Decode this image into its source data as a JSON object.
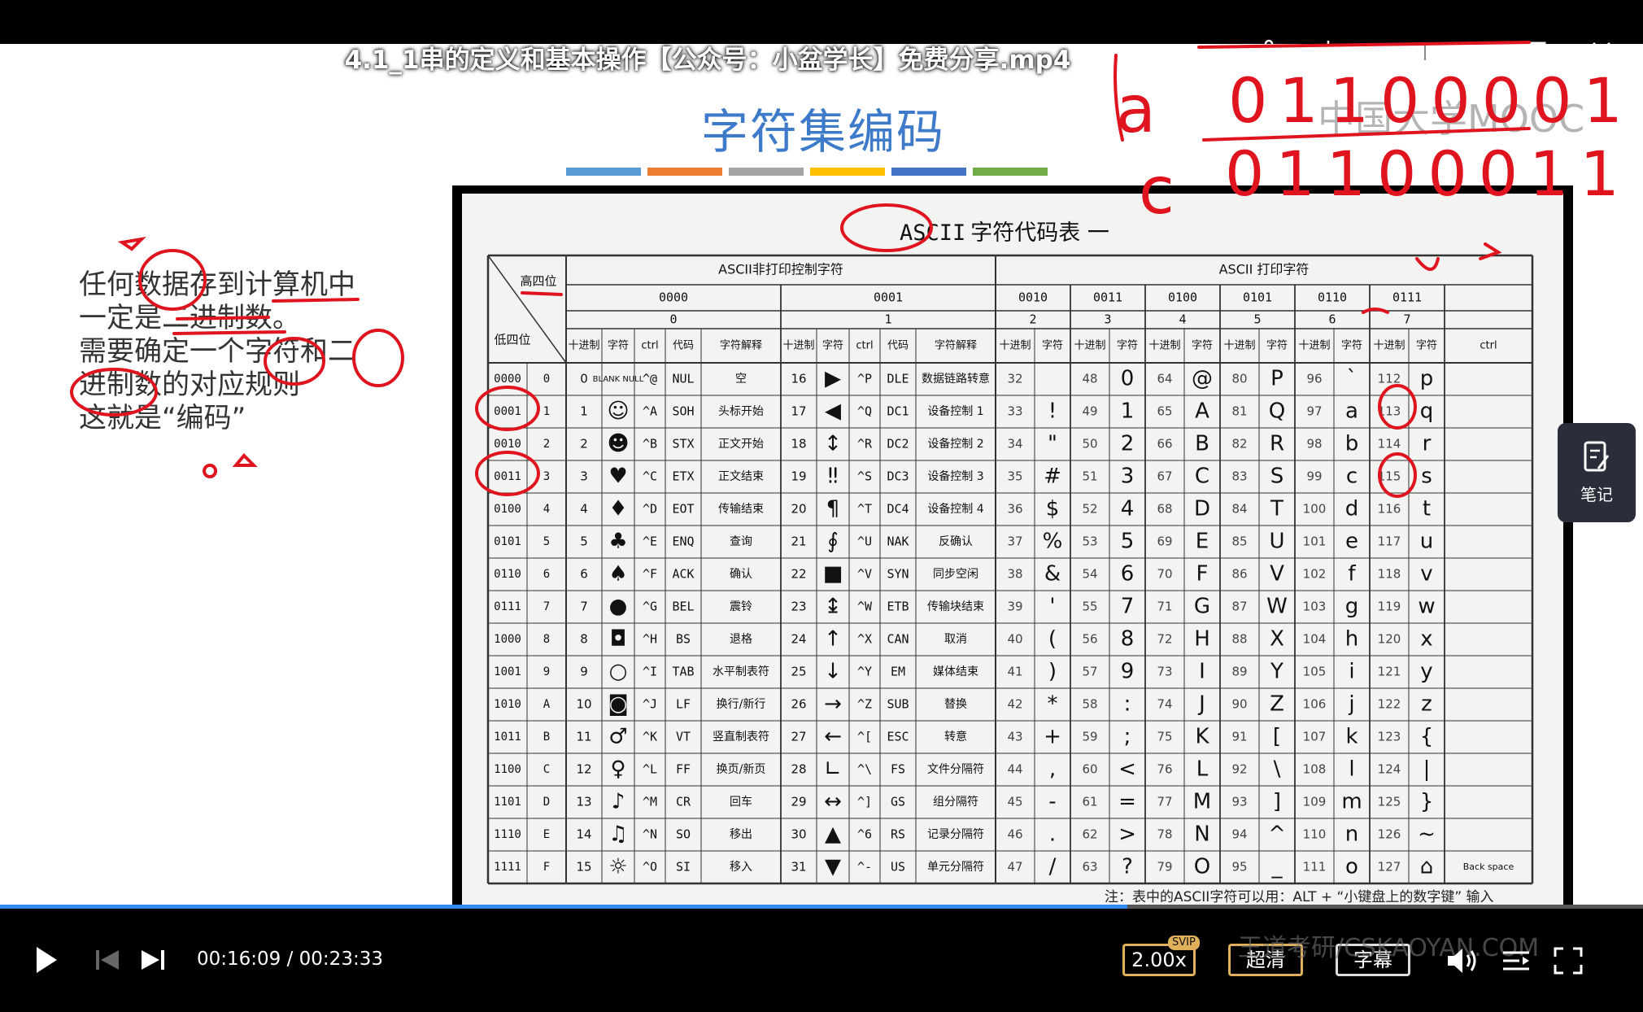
{
  "window": {
    "title": "4.1_1串的定义和基本操作【公众号：小盆学长】免费分享.mp4",
    "controls": [
      "share-icon",
      "download-icon",
      "more-icon",
      "minimize-icon",
      "maximize-icon",
      "close-icon"
    ]
  },
  "slide": {
    "title": "字符集编码",
    "bar_colors": [
      "#5b9bd5",
      "#ed7d31",
      "#a5a5a5",
      "#ffc000",
      "#4472c4",
      "#70ad47"
    ],
    "body_lines": "任何数据存到计算机中\n一定是二进制数。\n需要确定一个字符和二\n进制数的对应规则\n这就是“编码”",
    "watermark": "中国大学MOOC",
    "handwritten": [
      "a",
      "01100001",
      "c",
      "01100011"
    ]
  },
  "table": {
    "title_boxed": "ASCII",
    "title_rest": "字符代码表 一",
    "corner_high": "高四位",
    "corner_low": "低四位",
    "group1": "ASCII非打印控制字符",
    "group2": "ASCII 打印字符",
    "high_bits": [
      "0000",
      "0001",
      "0010",
      "0011",
      "0100",
      "0101",
      "0110",
      "0111"
    ],
    "high_idx": [
      "0",
      "1",
      "2",
      "3",
      "4",
      "5",
      "6",
      "7"
    ],
    "sub_ctrl": [
      "十进制",
      "字符",
      "ctrl",
      "代码",
      "字符解释"
    ],
    "sub_print": [
      "十进制",
      "字符"
    ],
    "sub_last_ctrl": "ctrl",
    "rows": [
      {
        "bin": "0000",
        "hex": "0",
        "c0": [
          "0",
          "BLANK NULL",
          "^@",
          "NUL",
          "空"
        ],
        "c1": [
          "16",
          "▶",
          "^P",
          "DLE",
          "数据链路转意"
        ],
        "p": [
          [
            "32",
            " "
          ],
          [
            "48",
            "0"
          ],
          [
            "64",
            "@"
          ],
          [
            "80",
            "P"
          ],
          [
            "96",
            "`"
          ],
          [
            "112",
            "p"
          ]
        ]
      },
      {
        "bin": "0001",
        "hex": "1",
        "c0": [
          "1",
          "☺",
          "^A",
          "SOH",
          "头标开始"
        ],
        "c1": [
          "17",
          "◀",
          "^Q",
          "DC1",
          "设备控制 1"
        ],
        "p": [
          [
            "33",
            "!"
          ],
          [
            "49",
            "1"
          ],
          [
            "65",
            "A"
          ],
          [
            "81",
            "Q"
          ],
          [
            "97",
            "a"
          ],
          [
            "113",
            "q"
          ]
        ]
      },
      {
        "bin": "0010",
        "hex": "2",
        "c0": [
          "2",
          "☻",
          "^B",
          "STX",
          "正文开始"
        ],
        "c1": [
          "18",
          "↕",
          "^R",
          "DC2",
          "设备控制 2"
        ],
        "p": [
          [
            "34",
            "\""
          ],
          [
            "50",
            "2"
          ],
          [
            "66",
            "B"
          ],
          [
            "82",
            "R"
          ],
          [
            "98",
            "b"
          ],
          [
            "114",
            "r"
          ]
        ]
      },
      {
        "bin": "0011",
        "hex": "3",
        "c0": [
          "3",
          "♥",
          "^C",
          "ETX",
          "正文结束"
        ],
        "c1": [
          "19",
          "‼",
          "^S",
          "DC3",
          "设备控制 3"
        ],
        "p": [
          [
            "35",
            "#"
          ],
          [
            "51",
            "3"
          ],
          [
            "67",
            "C"
          ],
          [
            "83",
            "S"
          ],
          [
            "99",
            "c"
          ],
          [
            "115",
            "s"
          ]
        ]
      },
      {
        "bin": "0100",
        "hex": "4",
        "c0": [
          "4",
          "♦",
          "^D",
          "EOT",
          "传输结束"
        ],
        "c1": [
          "20",
          "¶",
          "^T",
          "DC4",
          "设备控制 4"
        ],
        "p": [
          [
            "36",
            "$"
          ],
          [
            "52",
            "4"
          ],
          [
            "68",
            "D"
          ],
          [
            "84",
            "T"
          ],
          [
            "100",
            "d"
          ],
          [
            "116",
            "t"
          ]
        ]
      },
      {
        "bin": "0101",
        "hex": "5",
        "c0": [
          "5",
          "♣",
          "^E",
          "ENQ",
          "查询"
        ],
        "c1": [
          "21",
          "∮",
          "^U",
          "NAK",
          "反确认"
        ],
        "p": [
          [
            "37",
            "%"
          ],
          [
            "53",
            "5"
          ],
          [
            "69",
            "E"
          ],
          [
            "85",
            "U"
          ],
          [
            "101",
            "e"
          ],
          [
            "117",
            "u"
          ]
        ]
      },
      {
        "bin": "0110",
        "hex": "6",
        "c0": [
          "6",
          "♠",
          "^F",
          "ACK",
          "确认"
        ],
        "c1": [
          "22",
          "■",
          "^V",
          "SYN",
          "同步空闲"
        ],
        "p": [
          [
            "38",
            "&"
          ],
          [
            "54",
            "6"
          ],
          [
            "70",
            "F"
          ],
          [
            "86",
            "V"
          ],
          [
            "102",
            "f"
          ],
          [
            "118",
            "v"
          ]
        ]
      },
      {
        "bin": "0111",
        "hex": "7",
        "c0": [
          "7",
          "●",
          "^G",
          "BEL",
          "震铃"
        ],
        "c1": [
          "23",
          "↨",
          "^W",
          "ETB",
          "传输块结束"
        ],
        "p": [
          [
            "39",
            "'"
          ],
          [
            "55",
            "7"
          ],
          [
            "71",
            "G"
          ],
          [
            "87",
            "W"
          ],
          [
            "103",
            "g"
          ],
          [
            "119",
            "w"
          ]
        ]
      },
      {
        "bin": "1000",
        "hex": "8",
        "c0": [
          "8",
          "◘",
          "^H",
          "BS",
          "退格"
        ],
        "c1": [
          "24",
          "↑",
          "^X",
          "CAN",
          "取消"
        ],
        "p": [
          [
            "40",
            "("
          ],
          [
            "56",
            "8"
          ],
          [
            "72",
            "H"
          ],
          [
            "88",
            "X"
          ],
          [
            "104",
            "h"
          ],
          [
            "120",
            "x"
          ]
        ]
      },
      {
        "bin": "1001",
        "hex": "9",
        "c0": [
          "9",
          "○",
          "^I",
          "TAB",
          "水平制表符"
        ],
        "c1": [
          "25",
          "↓",
          "^Y",
          "EM",
          "媒体结束"
        ],
        "p": [
          [
            "41",
            ")"
          ],
          [
            "57",
            "9"
          ],
          [
            "73",
            "I"
          ],
          [
            "89",
            "Y"
          ],
          [
            "105",
            "i"
          ],
          [
            "121",
            "y"
          ]
        ]
      },
      {
        "bin": "1010",
        "hex": "A",
        "c0": [
          "10",
          "◙",
          "^J",
          "LF",
          "换行/新行"
        ],
        "c1": [
          "26",
          "→",
          "^Z",
          "SUB",
          "替换"
        ],
        "p": [
          [
            "42",
            "*"
          ],
          [
            "58",
            ":"
          ],
          [
            "74",
            "J"
          ],
          [
            "90",
            "Z"
          ],
          [
            "106",
            "j"
          ],
          [
            "122",
            "z"
          ]
        ]
      },
      {
        "bin": "1011",
        "hex": "B",
        "c0": [
          "11",
          "♂",
          "^K",
          "VT",
          "竖直制表符"
        ],
        "c1": [
          "27",
          "←",
          "^[",
          "ESC",
          "转意"
        ],
        "p": [
          [
            "43",
            "+"
          ],
          [
            "59",
            ";"
          ],
          [
            "75",
            "K"
          ],
          [
            "91",
            "["
          ],
          [
            "107",
            "k"
          ],
          [
            "123",
            "{"
          ]
        ]
      },
      {
        "bin": "1100",
        "hex": "C",
        "c0": [
          "12",
          "♀",
          "^L",
          "FF",
          "换页/新页"
        ],
        "c1": [
          "28",
          "∟",
          "^\\",
          "FS",
          "文件分隔符"
        ],
        "p": [
          [
            "44",
            ","
          ],
          [
            "60",
            "<"
          ],
          [
            "76",
            "L"
          ],
          [
            "92",
            "\\"
          ],
          [
            "108",
            "l"
          ],
          [
            "124",
            "|"
          ]
        ]
      },
      {
        "bin": "1101",
        "hex": "D",
        "c0": [
          "13",
          "♪",
          "^M",
          "CR",
          "回车"
        ],
        "c1": [
          "29",
          "↔",
          "^]",
          "GS",
          "组分隔符"
        ],
        "p": [
          [
            "45",
            "-"
          ],
          [
            "61",
            "="
          ],
          [
            "77",
            "M"
          ],
          [
            "93",
            "]"
          ],
          [
            "109",
            "m"
          ],
          [
            "125",
            "}"
          ]
        ]
      },
      {
        "bin": "1110",
        "hex": "E",
        "c0": [
          "14",
          "♫",
          "^N",
          "SO",
          "移出"
        ],
        "c1": [
          "30",
          "▲",
          "^6",
          "RS",
          "记录分隔符"
        ],
        "p": [
          [
            "46",
            "."
          ],
          [
            "62",
            ">"
          ],
          [
            "78",
            "N"
          ],
          [
            "94",
            "^"
          ],
          [
            "110",
            "n"
          ],
          [
            "126",
            "~"
          ]
        ]
      },
      {
        "bin": "1111",
        "hex": "F",
        "c0": [
          "15",
          "☼",
          "^O",
          "SI",
          "移入"
        ],
        "c1": [
          "31",
          "▼",
          "^-",
          "US",
          "单元分隔符"
        ],
        "p": [
          [
            "47",
            "/"
          ],
          [
            "63",
            "?"
          ],
          [
            "79",
            "O"
          ],
          [
            "95",
            "_"
          ],
          [
            "111",
            "o"
          ],
          [
            "127",
            "⌂"
          ]
        ]
      }
    ],
    "last_ctrl_cell": "Back space",
    "note": "注：表中的ASCII字符可以用：ALT + “小键盘上的数字键” 输入"
  },
  "player": {
    "time": "00:16:09 / 00:23:33",
    "progress": 0.686,
    "speed": "2.00x",
    "svip_badge": "SVIP",
    "quality": "超清",
    "subtitle": "字幕",
    "notes_label": "笔记",
    "brand_watermark": "王道考研/CSKAOYAN.COM"
  },
  "colors": {
    "accent": "#2f8cf4",
    "speed_border": "#e0b15a",
    "annotation_red": "#e0141e",
    "slide_title": "#3d7ac9"
  }
}
